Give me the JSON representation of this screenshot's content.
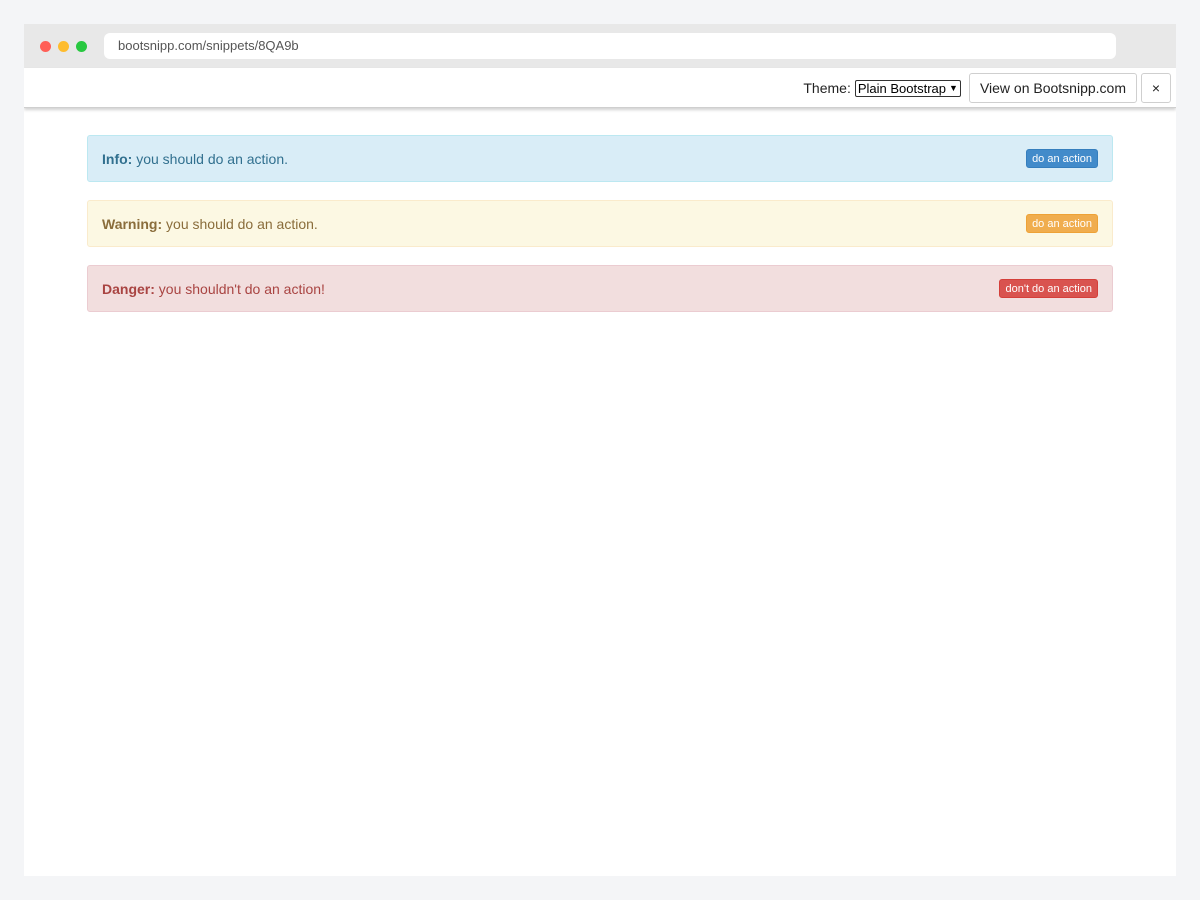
{
  "browser": {
    "url": "bootsnipp.com/snippets/8QA9b",
    "traffic_light_colors": {
      "close": "#ff5f57",
      "minimize": "#febc2e",
      "maximize": "#28c840"
    }
  },
  "toolbar": {
    "theme_label": "Theme:",
    "theme_selected": "Plain Bootstrap",
    "view_button": "View on Bootsnipp.com",
    "close_button": "×"
  },
  "alerts": [
    {
      "type": "info",
      "title": "Info:",
      "message": "you should do an action.",
      "button": "do an action",
      "colors": {
        "background": "#d9edf7",
        "text": "#31708f",
        "button": "#428bca"
      }
    },
    {
      "type": "warning",
      "title": "Warning:",
      "message": "you should do an action.",
      "button": "do an action",
      "colors": {
        "background": "#fcf8e3",
        "text": "#8a6d3b",
        "button": "#f0ad4e"
      }
    },
    {
      "type": "danger",
      "title": "Danger:",
      "message": "you shouldn't do an action!",
      "button": "don't do an action",
      "colors": {
        "background": "#f2dede",
        "text": "#a94442",
        "button": "#d9534f"
      }
    }
  ]
}
